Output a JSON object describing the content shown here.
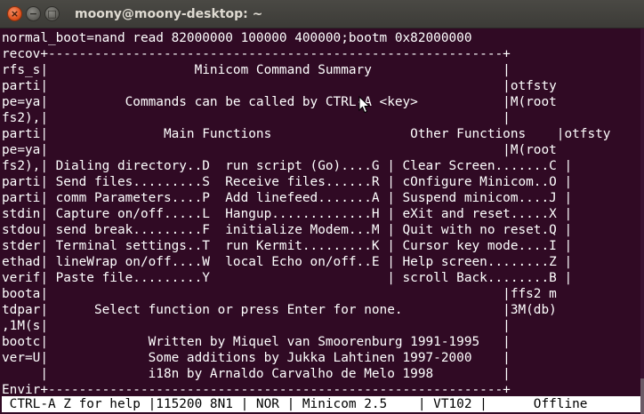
{
  "window": {
    "title": "moony@moony-desktop: ~",
    "close_glyph": "×",
    "minimize_glyph": "−",
    "maximize_glyph": "□"
  },
  "terminal": {
    "lines": [
      "normal_boot=nand read 82000000 100000 400000;bootm 0x82000000",
      "recov+-----------------------------------------------------------+",
      "rfs_s|                   Minicom Command Summary                 |",
      "parti|                                                           |otfsty",
      "pe=ya|          Commands can be called by CTRL-A <key>           |M(root",
      "fs2),|                                                           |",
      "parti|               Main Functions                  Other Functions    |otfsty",
      "pe=ya|                                                           |M(root",
      "fs2),| Dialing directory..D  run script (Go)....G | Clear Screen.......C |",
      "parti| Send files.........S  Receive files......R | cOnfigure Minicom..O |",
      "parti| comm Parameters....P  Add linefeed.......A | Suspend minicom....J |",
      "stdin| Capture on/off.....L  Hangup.............H | eXit and reset.....X |",
      "stdou| send break.........F  initialize Modem...M | Quit with no reset.Q |",
      "stder| Terminal settings..T  run Kermit.........K | Cursor key mode....I |",
      "ethad| lineWrap on/off....W  local Echo on/off..E | Help screen........Z |",
      "verif| Paste file.........Y                       | scroll Back........B |",
      "boota|                                                           |ffs2 m",
      "tdpar|      Select function or press Enter for none.             |3M(db)",
      ",1M(s|                                                           |",
      "bootc|             Written by Miquel van Smoorenburg 1991-1995   |",
      "ver=U|             Some additions by Jukka Lahtinen 1997-2000    |",
      "     |             i18n by Arnaldo Carvalho de Melo 1998         |",
      "Envir+-----------------------------------------------------------+"
    ]
  },
  "status_bar": {
    "text": " CTRL-A Z for help |115200 8N1 | NOR | Minicom 2.5    | VT102 |      Offline"
  },
  "icons": {
    "cursor": "mouse-pointer-icon"
  },
  "colors": {
    "terminal_background": "#300a24",
    "terminal_text": "#ffffff",
    "close_button": "#e0541f"
  }
}
